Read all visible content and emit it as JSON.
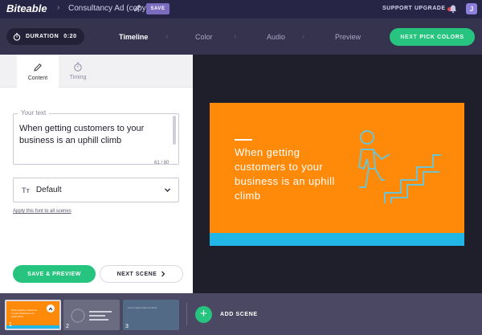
{
  "app": {
    "logo": "Biteable",
    "project_name": "Consultancy Ad (copy)",
    "save_label": "SAVE",
    "support_label": "SUPPORT",
    "upgrade_label": "UPGRADE",
    "avatar_initial": "J"
  },
  "stepbar": {
    "duration_label": "DURATION",
    "duration_value": "0:20",
    "steps": [
      {
        "label": "Timeline",
        "active": true
      },
      {
        "label": "Color",
        "active": false
      },
      {
        "label": "Audio",
        "active": false
      },
      {
        "label": "Preview",
        "active": false
      }
    ],
    "next_prefix": "NEXT",
    "next_label": "PICK COLORS"
  },
  "panel": {
    "tabs": [
      {
        "label": "Content",
        "icon": "pencil-icon",
        "active": true
      },
      {
        "label": "Timing",
        "icon": "stopwatch-icon",
        "active": false
      }
    ],
    "text_field_label": "Your text",
    "text_value": "When getting customers to your business is an uphill climb",
    "char_count": "61 / 80",
    "font_icon": "Tт",
    "font_value": "Default",
    "apply_link": "Apply this font to all scenes",
    "save_preview_label": "SAVE & PREVIEW",
    "next_scene_label": "NEXT SCENE"
  },
  "scene": {
    "headline": "When getting customers to your business is an uphill climb",
    "background_color": "#ff8a0a",
    "bar_color": "#22b6e6",
    "illustration": "person-climbing-stairs-icon"
  },
  "timeline": {
    "scenes": [
      {
        "number": "1",
        "text": "When getting customers to your business is an uphill climb",
        "selected": true
      },
      {
        "number": "2",
        "selected": false
      },
      {
        "number": "3",
        "text": "Lorem ipsum dolor sit amet",
        "selected": false
      }
    ],
    "add_scene_label": "ADD SCENE"
  },
  "colors": {
    "accent_green": "#26c47e",
    "topbar": "#272545",
    "stepbar": "#36334f"
  }
}
